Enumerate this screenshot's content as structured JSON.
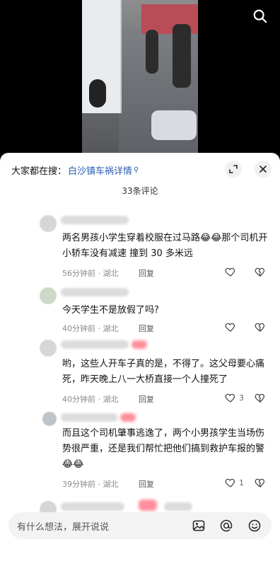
{
  "top_bar": {
    "search_icon": "search-icon"
  },
  "sheet": {
    "search_prefix": "大家都在搜：",
    "search_link": "白沙镇车祸详情",
    "comment_count": "33条评论",
    "collapse_icon": "collapse-icon",
    "close_icon": "close-icon"
  },
  "comments": [
    {
      "text": "两名男孩小学生穿着校服在过马路😂😂那个司机开小轿车没有减速 撞到 30 多米远",
      "time_location": "56分钟前 · 湖北",
      "reply_label": "回复",
      "like_count": ""
    },
    {
      "text": "今天学生不是放假了吗?",
      "time_location": "40分钟前 · 湖北",
      "reply_label": "回复",
      "like_count": ""
    },
    {
      "text": "哟，这些人开车子真的是，不得了。这父母要心痛死，昨天晚上八一大桥直接一个人撞死了",
      "time_location": "40分钟前 · 湖北",
      "reply_label": "回复",
      "like_count": "3"
    },
    {
      "text": "而且这个司机肇事逃逸了，两个小男孩学生当场伤势很严重，还是我们帮忙把他们搞到救护车报的警😂😂",
      "time_location": "39分钟前 · 湖北",
      "reply_label": "回复",
      "like_count": "1"
    }
  ],
  "input": {
    "placeholder": "有什么想法，展开说说",
    "image_icon": "image-icon",
    "mention_icon": "at-mention-icon",
    "emoji_icon": "emoji-icon"
  }
}
